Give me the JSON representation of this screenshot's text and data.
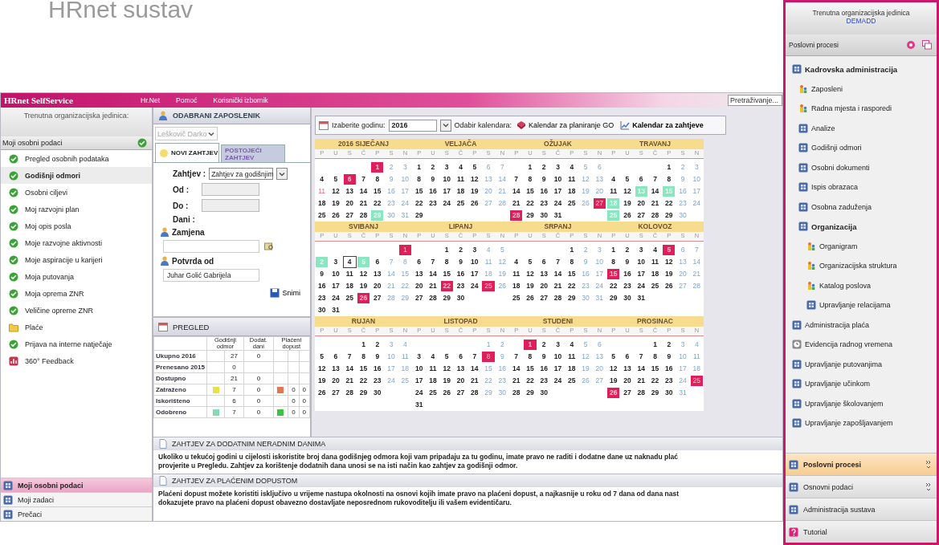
{
  "page_title": "HRnet sustav",
  "top_bar": {
    "brand": "HRnet SelfService",
    "menu": [
      "Hr.Net",
      "Pomoć",
      "Korisnički izbornik"
    ],
    "search": {
      "placeholder": "Pretraživanje..."
    }
  },
  "left_sidebar": {
    "org_label": "Trenutna organizacijska jedinica:",
    "section": "Moji osobni podaci",
    "items": [
      {
        "label": "Pregled osobnih podataka",
        "kind": "personal",
        "selected": false
      },
      {
        "label": "Godišnji odmori",
        "kind": "personal",
        "selected": true
      },
      {
        "label": "Osobni ciljevi",
        "kind": "personal",
        "selected": false
      },
      {
        "label": "Moj razvojni plan",
        "kind": "personal",
        "selected": false
      },
      {
        "label": "Moj opis posla",
        "kind": "personal",
        "selected": false
      },
      {
        "label": "Moje razvojne aktivnosti",
        "kind": "personal",
        "selected": false
      },
      {
        "label": "Moje aspiracije u karijeri",
        "kind": "personal",
        "selected": false
      },
      {
        "label": "Moja putovanja",
        "kind": "personal",
        "selected": false
      },
      {
        "label": "Moja oprema ZNR",
        "kind": "personal",
        "selected": false
      },
      {
        "label": "Veličine opreme ZNR",
        "kind": "personal",
        "selected": false
      },
      {
        "label": "Plaće",
        "kind": "folder",
        "selected": false
      },
      {
        "label": "Prijava na interne natječaje",
        "kind": "personal",
        "selected": false
      },
      {
        "label": "360° Feedback",
        "kind": "feedback",
        "selected": false
      }
    ],
    "bottom_nav": [
      {
        "label": "Moji osobni podaci",
        "selected": true
      },
      {
        "label": "Moji zadaci",
        "selected": false
      },
      {
        "label": "Prečaci",
        "selected": false
      }
    ]
  },
  "employee_panel": {
    "title": "ODABRANI ZAPOSLENIK",
    "employee": {
      "value": "Leškovič Darko",
      "disabled": true
    },
    "tabs": [
      {
        "label": "NOVI ZAHTJEV",
        "selected": true
      },
      {
        "label": "POSTOJEĆI ZAHTJEV",
        "selected": false
      }
    ],
    "form": {
      "request_label": "Zahtjev :",
      "request_value": "Zahtjev za godišnjim",
      "from_label": "Od :",
      "to_label": "Do :",
      "days_label": "Dani :",
      "substitute_label": "Zamjena",
      "approver_label": "Potvrda od",
      "approver_value": "Juhar Golić Gabrijela",
      "save": "Snimi"
    }
  },
  "overview": {
    "title": "PREGLED",
    "columns": [
      "Godišnji odmor",
      "Dodat. dani",
      "Plaćeni dopust"
    ],
    "rows": [
      {
        "label": "Ukupno 2016",
        "annual": "27",
        "extra": "0"
      },
      {
        "label": "Prenesano 2015",
        "annual": "0"
      },
      {
        "label": "Dostupno",
        "annual": "21",
        "extra": "0"
      },
      {
        "label": "Zatraženo",
        "annual_marker": {
          "color": "#e8e24a"
        },
        "annual": "7",
        "extra": "0",
        "paid_marker": {
          "color": "#e0784a"
        },
        "paid": [
          "0",
          "0"
        ]
      },
      {
        "label": "Iskorišteno",
        "annual": "6",
        "extra": "0",
        "paid": [
          "0",
          "0"
        ]
      },
      {
        "label": "Odobreno",
        "annual_marker": {
          "color": "#7fdcb4"
        },
        "annual": "7",
        "extra": "0",
        "paid_marker": {
          "color": "#3cc43c"
        },
        "paid": [
          "0",
          "0"
        ]
      }
    ]
  },
  "calendar": {
    "year_label": "Izaberite godinu:",
    "year": "2016",
    "picker_label": "Odabir kalendara:",
    "options": [
      {
        "label": "Kalendar za planiranje GO",
        "selected": false
      },
      {
        "label": "Kalendar za zahtjeve",
        "selected": true
      }
    ],
    "months": [
      {
        "name": "2016 SIJEČANJ",
        "weekdays": [
          "P",
          "U",
          "S",
          "Č",
          "P",
          "S",
          "N"
        ],
        "weeks": [
          {
            "align_right": true,
            "days": [
              {
                "d": "1",
                "holiday": true
              },
              "2",
              "3"
            ]
          },
          {
            "days": [
              "4",
              "5",
              {
                "d": "6",
                "holiday": true
              },
              "7",
              "8",
              "9",
              "10"
            ]
          },
          {
            "days": [
              {
                "d": "11",
                "pending": true
              },
              "12",
              "13",
              "14",
              "15",
              "16",
              "17"
            ]
          },
          {
            "days": [
              "18",
              "19",
              "20",
              "21",
              "22",
              "23",
              "24"
            ]
          },
          {
            "days": [
              "25",
              "26",
              "27",
              "28",
              {
                "d": "29",
                "leave": true
              },
              "30",
              "31"
            ]
          }
        ]
      },
      {
        "name": "VELJAČA",
        "weekdays": [
          "P",
          "U",
          "S",
          "Č",
          "P",
          "S",
          "N"
        ],
        "weeks": [
          {
            "days": [
              "1",
              "2",
              "3",
              "4",
              "5",
              "6",
              "7"
            ]
          },
          {
            "days": [
              "8",
              "9",
              "10",
              "11",
              "12",
              "13",
              "14"
            ]
          },
          {
            "days": [
              "15",
              "16",
              "17",
              "18",
              "19",
              "20",
              "21"
            ]
          },
          {
            "days": [
              "22",
              "23",
              "24",
              "25",
              "26",
              "27",
              "28"
            ]
          },
          {
            "days": [
              "29"
            ]
          }
        ]
      },
      {
        "name": "OŽUJAK",
        "weekdays": [
          "P",
          "U",
          "S",
          "Č",
          "P",
          "S",
          "N"
        ],
        "weeks": [
          {
            "align_right": true,
            "days": [
              "1",
              "2",
              "3",
              "4",
              "5",
              "6"
            ]
          },
          {
            "days": [
              "7",
              "8",
              "9",
              "10",
              "11",
              "12",
              "13"
            ]
          },
          {
            "days": [
              "14",
              "15",
              "16",
              "17",
              "18",
              "19",
              "20"
            ]
          },
          {
            "days": [
              "21",
              "22",
              "23",
              "24",
              "25",
              "26",
              {
                "d": "27",
                "holiday": true
              }
            ]
          },
          {
            "days": [
              {
                "d": "28",
                "holiday": true
              },
              "29",
              "30",
              "31"
            ]
          }
        ]
      },
      {
        "name": "TRAVANJ",
        "weekdays": [
          "P",
          "U",
          "S",
          "Č",
          "P",
          "S",
          "N"
        ],
        "weeks": [
          {
            "align_right": true,
            "days": [
              "1",
              "2",
              "3"
            ]
          },
          {
            "days": [
              "4",
              "5",
              "6",
              "7",
              "8",
              "9",
              "10"
            ]
          },
          {
            "days": [
              "11",
              "12",
              {
                "d": "13",
                "leave": true
              },
              "14",
              {
                "d": "15",
                "leave": true
              },
              "16",
              "17"
            ]
          },
          {
            "days": [
              {
                "d": "18",
                "leave": true
              },
              "19",
              "20",
              "21",
              "22",
              "23",
              "24"
            ]
          },
          {
            "days": [
              {
                "d": "25",
                "leave": true
              },
              "26",
              "27",
              "28",
              "29",
              "30"
            ]
          }
        ]
      },
      {
        "name": "SVIBANJ",
        "weekdays": [
          "P",
          "U",
          "S",
          "Č",
          "P",
          "S",
          "N"
        ],
        "weeks": [
          {
            "align_right": true,
            "days": [
              {
                "d": "1",
                "holiday": true
              }
            ]
          },
          {
            "days": [
              {
                "d": "2",
                "leave": true
              },
              "3",
              {
                "d": "4",
                "today": true
              },
              {
                "d": "5",
                "leave": true
              },
              "6",
              "7",
              "8"
            ]
          },
          {
            "days": [
              "9",
              "10",
              "11",
              "12",
              "13",
              "14",
              "15"
            ]
          },
          {
            "days": [
              "16",
              "17",
              "18",
              "19",
              "20",
              "21",
              "22"
            ]
          },
          {
            "days": [
              "23",
              "24",
              "25",
              {
                "d": "26",
                "holiday": true
              },
              "27",
              "28",
              "29"
            ]
          },
          {
            "days": [
              "30",
              "31"
            ]
          }
        ]
      },
      {
        "name": "LIPANJ",
        "weekdays": [
          "P",
          "U",
          "S",
          "Č",
          "P",
          "S",
          "N"
        ],
        "weeks": [
          {
            "align_right": true,
            "days": [
              "1",
              "2",
              "3",
              "4",
              "5"
            ]
          },
          {
            "days": [
              "6",
              "7",
              "8",
              "9",
              "10",
              "11",
              "12"
            ]
          },
          {
            "days": [
              "13",
              "14",
              "15",
              "16",
              "17",
              "18",
              "19"
            ]
          },
          {
            "days": [
              "20",
              "21",
              {
                "d": "22",
                "holiday": true
              },
              "23",
              "24",
              {
                "d": "25",
                "holiday": true
              },
              "26"
            ]
          },
          {
            "days": [
              "27",
              "28",
              "29",
              "30"
            ]
          }
        ]
      },
      {
        "name": "SRPANJ",
        "weekdays": [
          "P",
          "U",
          "S",
          "Č",
          "P",
          "S",
          "N"
        ],
        "weeks": [
          {
            "align_right": true,
            "days": [
              "1",
              "2",
              "3"
            ]
          },
          {
            "days": [
              "4",
              "5",
              "6",
              "7",
              "8",
              "9",
              "10"
            ]
          },
          {
            "days": [
              "11",
              "12",
              "13",
              "14",
              "15",
              "16",
              "17"
            ]
          },
          {
            "days": [
              "18",
              "19",
              "20",
              "21",
              "22",
              "23",
              "24"
            ]
          },
          {
            "days": [
              "25",
              "26",
              "27",
              "28",
              "29",
              "30",
              "31"
            ]
          }
        ]
      },
      {
        "name": "KOLOVOZ",
        "weekdays": [
          "P",
          "U",
          "S",
          "Č",
          "P",
          "S",
          "N"
        ],
        "weeks": [
          {
            "days": [
              "1",
              "2",
              "3",
              "4",
              {
                "d": "5",
                "holiday": true
              },
              "6",
              "7"
            ]
          },
          {
            "days": [
              "8",
              "9",
              "10",
              "11",
              "12",
              "13",
              "14"
            ]
          },
          {
            "days": [
              {
                "d": "15",
                "holiday": true
              },
              "16",
              "17",
              "18",
              "19",
              "20",
              "21"
            ]
          },
          {
            "days": [
              "22",
              "23",
              "24",
              "25",
              "26",
              "27",
              "28"
            ]
          },
          {
            "days": [
              "29",
              "30",
              "31"
            ]
          }
        ]
      },
      {
        "name": "RUJAN",
        "weekdays": [
          "P",
          "U",
          "S",
          "Č",
          "P",
          "S",
          "N"
        ],
        "weeks": [
          {
            "align_right": true,
            "days": [
              "1",
              "2",
              "3",
              "4"
            ]
          },
          {
            "days": [
              "5",
              "6",
              "7",
              "8",
              "9",
              "10",
              "11"
            ]
          },
          {
            "days": [
              "12",
              "13",
              "14",
              "15",
              "16",
              "17",
              "18"
            ]
          },
          {
            "days": [
              "19",
              "20",
              "21",
              "22",
              "23",
              "24",
              "25"
            ]
          },
          {
            "days": [
              "26",
              "27",
              "28",
              "29",
              "30"
            ]
          }
        ]
      },
      {
        "name": "LISTOPAD",
        "weekdays": [
          "P",
          "U",
          "S",
          "Č",
          "P",
          "S",
          "N"
        ],
        "weeks": [
          {
            "align_right": true,
            "days": [
              "1",
              "2"
            ]
          },
          {
            "days": [
              "3",
              "4",
              "5",
              "6",
              "7",
              {
                "d": "8",
                "holiday": true
              },
              "9"
            ]
          },
          {
            "days": [
              "10",
              "11",
              "12",
              "13",
              "14",
              "15",
              "16"
            ]
          },
          {
            "days": [
              "17",
              "18",
              "19",
              "20",
              "21",
              "22",
              "23"
            ]
          },
          {
            "days": [
              "24",
              "25",
              "26",
              "27",
              "28",
              "29",
              "30"
            ]
          },
          {
            "days": [
              "31"
            ]
          }
        ]
      },
      {
        "name": "STUDENI",
        "weekdays": [
          "P",
          "U",
          "S",
          "Č",
          "P",
          "S",
          "N"
        ],
        "weeks": [
          {
            "align_right": true,
            "days": [
              {
                "d": "1",
                "holiday": true
              },
              "2",
              "3",
              "4",
              "5",
              "6"
            ]
          },
          {
            "days": [
              "7",
              "8",
              "9",
              "10",
              "11",
              "12",
              "13"
            ]
          },
          {
            "days": [
              "14",
              "15",
              "16",
              "17",
              "18",
              "19",
              "20"
            ]
          },
          {
            "days": [
              "21",
              "22",
              "23",
              "24",
              "25",
              "26",
              "27"
            ]
          },
          {
            "days": [
              "28",
              "29",
              "30"
            ]
          }
        ]
      },
      {
        "name": "PROSINAC",
        "weekdays": [
          "P",
          "U",
          "S",
          "Č",
          "P",
          "S",
          "N"
        ],
        "weeks": [
          {
            "align_right": true,
            "days": [
              "1",
              "2",
              "3",
              "4"
            ]
          },
          {
            "days": [
              "5",
              "6",
              "7",
              "8",
              "9",
              "10",
              "11"
            ]
          },
          {
            "days": [
              "12",
              "13",
              "14",
              "15",
              "16",
              "17",
              "18"
            ]
          },
          {
            "days": [
              "19",
              "20",
              "21",
              "22",
              "23",
              "24",
              {
                "d": "25",
                "holiday": true
              }
            ]
          },
          {
            "days": [
              {
                "d": "26",
                "holiday": true
              },
              "27",
              "28",
              "29",
              "30",
              "31"
            ]
          }
        ]
      }
    ]
  },
  "info_sections": [
    {
      "title": "ZAHTJEV ZA DODATNIM NERADNIM DANIMA",
      "lines": [
        "Ukoliko u tekućoj godini u cijelosti iskoristite broj dana godišnjeg odmora koji vam pripadaju za tu godinu, imate pravo ne raditi i dodatne dane uz naknadu plać",
        "provjerite u Pregledu. Zahtjev za korištenje dodatnih dana unosi se na isti način kao zahtjev za godišnji odmor."
      ]
    },
    {
      "title": "ZAHTJEV ZA PLAĆENIM DOPUSTOM",
      "lines": [
        "Plaćeni dopust možete koristiti isključivo u vrijeme nastupa okolnosti na osnovi kojih imate pravo na plaćeni dopust, a najkasnije u roku od 7 dana od dana nast",
        "dokazujete pravo na plaćeni dopust obavezno dostavljate neposrednom rukovoditelju ili vašem evidentičaru."
      ]
    }
  ],
  "right_panel": {
    "org_label": "Trenutna organizacijska jedinica",
    "org_value": "DEMADD",
    "section": "Poslovni procesi",
    "tree": [
      {
        "label": "Kadrovska administracija",
        "kind": "module",
        "children": [
          {
            "label": "Zaposleni",
            "kind": "staff"
          },
          {
            "label": "Radna mjesta i rasporedi",
            "kind": "staff"
          },
          {
            "label": "Analize",
            "kind": "module"
          },
          {
            "label": "Godišnji odmori",
            "kind": "module"
          },
          {
            "label": "Osobni dokumenti",
            "kind": "module"
          },
          {
            "label": "Ispis obrazaca",
            "kind": "module"
          },
          {
            "label": "Osobna zaduženja",
            "kind": "module"
          },
          {
            "label": "Organizacija",
            "kind": "module",
            "children": [
              {
                "label": "Organigram",
                "kind": "staff"
              },
              {
                "label": "Organizacijska struktura",
                "kind": "staff"
              },
              {
                "label": "Katalog poslova",
                "kind": "staff"
              },
              {
                "label": "Upravljanje relacijama",
                "kind": "module"
              }
            ]
          }
        ]
      },
      {
        "label": "Administracija plaća",
        "kind": "module"
      },
      {
        "label": "Evidencija radnog vremena",
        "kind": "clock"
      },
      {
        "label": "Upravljanje putovanjima",
        "kind": "module"
      },
      {
        "label": "Upravljanje učinkom",
        "kind": "module"
      },
      {
        "label": "Upravljanje školovanjem",
        "kind": "module"
      },
      {
        "label": "Upravljanje zapošljavanjem",
        "kind": "module"
      }
    ],
    "bottom_nav": [
      {
        "label": "Poslovni procesi",
        "kind": "module",
        "selected": true,
        "expandable": true
      },
      {
        "label": "Osnovni podaci",
        "kind": "module",
        "selected": false,
        "expandable": true
      },
      {
        "label": "Administracija sustava",
        "kind": "module",
        "selected": false,
        "expandable": false
      },
      {
        "label": "Tutorial",
        "kind": "help",
        "selected": false,
        "expandable": false
      }
    ]
  }
}
